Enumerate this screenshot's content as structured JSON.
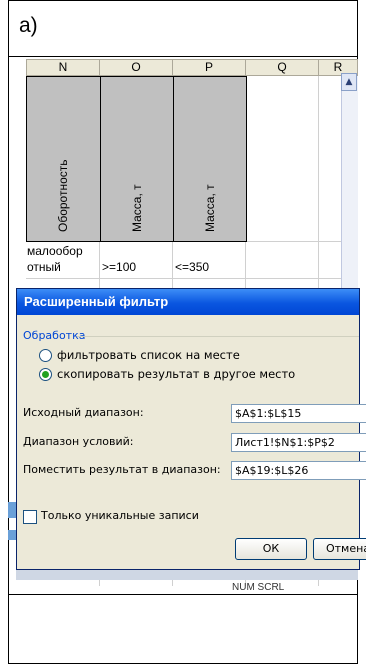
{
  "figure_label": "а)",
  "spreadsheet": {
    "columns": [
      "N",
      "O",
      "P",
      "Q",
      "R"
    ],
    "header_cells": [
      "Оборотность",
      "Масса, т",
      "Масса, т"
    ],
    "criteria_row": {
      "n": [
        "малообор",
        "отный"
      ],
      "o": ">=100",
      "p": "<=350"
    },
    "bottom_text": "NUM SCRL"
  },
  "dialog": {
    "title": "Расширенный фильтр",
    "group_label": "Обработка",
    "options": [
      {
        "label": "фильтровать список на месте",
        "selected": false
      },
      {
        "label": "скопировать результат в другое место",
        "selected": true
      }
    ],
    "fields": [
      {
        "label": "Исходный диапазон:",
        "value": "$A$1:$L$15"
      },
      {
        "label": "Диапазон условий:",
        "value": "Лист1!$N$1:$P$2"
      },
      {
        "label": "Поместить результат в диапазон:",
        "value": "$A$19:$L$26"
      }
    ],
    "unique_only_label": "Только уникальные записи",
    "unique_only_checked": false,
    "ok_label": "ОК",
    "cancel_label": "Отмена"
  },
  "colors": {
    "title_bar": "#0a56e0",
    "dialog_bg": "#ece9d8",
    "header_cells": "#c0c0c0",
    "accent_text": "#0046d5"
  }
}
